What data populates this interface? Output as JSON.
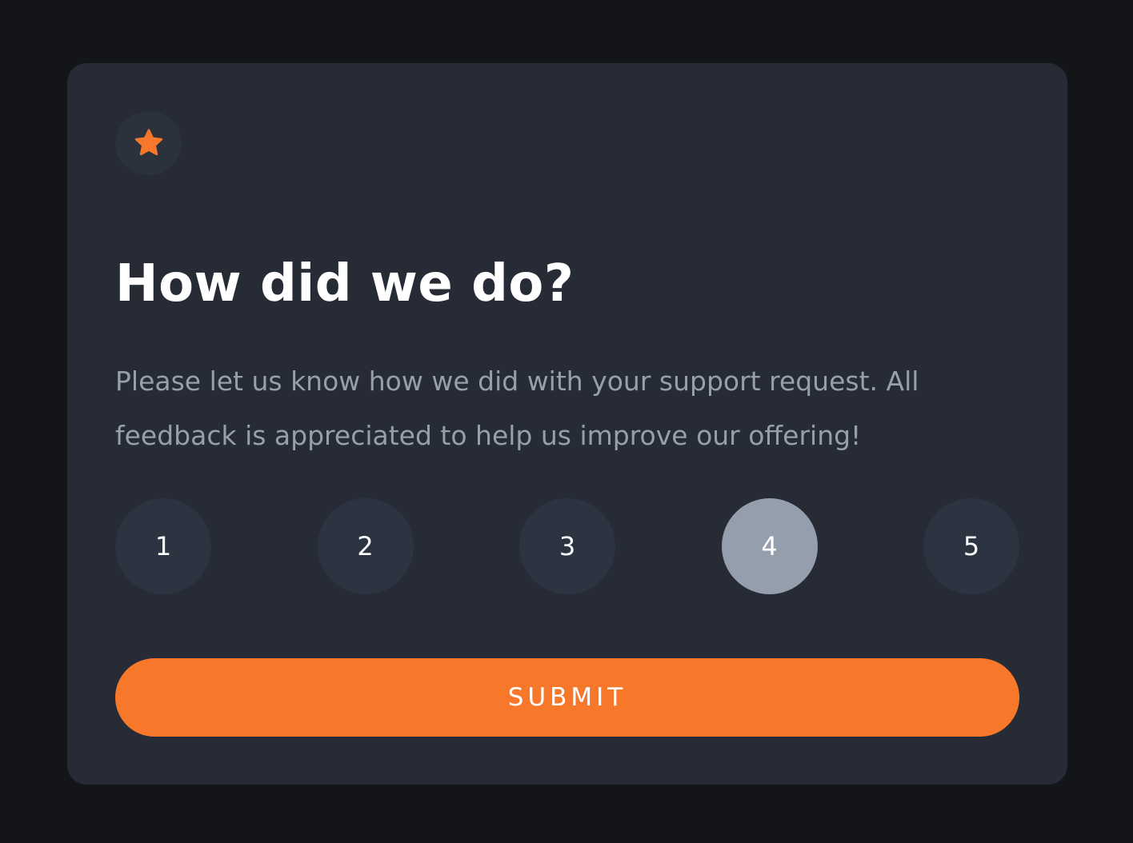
{
  "card": {
    "title": "How did we do?",
    "description": "Please let us know how we did with your support request. All feedback is appreciated to help us improve our offering!",
    "icon": "star-icon"
  },
  "ratings": {
    "options": [
      "1",
      "2",
      "3",
      "4",
      "5"
    ],
    "selected": "4"
  },
  "submit": {
    "label": "SUBMIT"
  },
  "colors": {
    "background": "#131518",
    "card": "#262b35",
    "accent": "#f7772b",
    "rating_default": "#2c3441",
    "rating_selected": "#959eac",
    "muted_text": "#969fac"
  }
}
